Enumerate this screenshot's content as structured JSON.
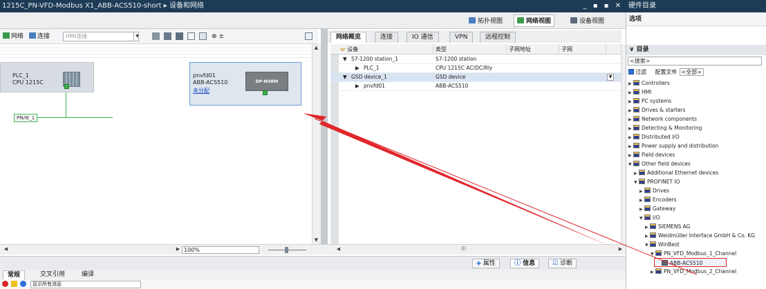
{
  "window": {
    "title": "1215C_PN-VFD-Modbus X1_ABB-ACS510-short ▸ 设备和网络",
    "controls": "_ ▪ ▪ ✕",
    "right_title": "硬件目录"
  },
  "views": {
    "topology": "拓扑视图",
    "network": "网络视图",
    "device": "设备视图"
  },
  "toolbar": {
    "network": "网络",
    "connect": "连接",
    "hmi_placeholder": "HMI连接",
    "zoom_icon": "⊕ ±"
  },
  "canvas": {
    "plc": {
      "name": "PLC_1",
      "type": "CPU 1215C"
    },
    "vfd": {
      "name": "pnvfd01",
      "type": "ABB-ACS510",
      "status": "未分配",
      "module": "DP-NORM"
    },
    "subnet": "PN/IE_1"
  },
  "tabs": [
    "网络概览",
    "连接",
    "IO 通信",
    "VPN",
    "远程控制"
  ],
  "table": {
    "headers": [
      "设备",
      "类型",
      "子网地址",
      "子网"
    ],
    "rows": [
      {
        "indent": 1,
        "expand": "▼",
        "device": "S7-1200 station_1",
        "type": "S7-1200 station"
      },
      {
        "indent": 2,
        "expand": "▶",
        "device": "PLC_1",
        "type": "CPU 1215C AC/DC/Rly"
      },
      {
        "indent": 1,
        "expand": "▼",
        "device": "GSD device_1",
        "type": "GSD device",
        "selected": true
      },
      {
        "indent": 2,
        "expand": "▶",
        "device": "pnvfd01",
        "type": "ABB-ACS510"
      }
    ]
  },
  "bottom": {
    "zoom": "100%",
    "scroll_marker": "III"
  },
  "inspector": {
    "properties": "属性",
    "info": "信息",
    "diagnostics": "诊断"
  },
  "general_tabs": [
    "常规",
    "交叉引用",
    "编译"
  ],
  "messages": {
    "filter": "显示所有消息"
  },
  "catalog": {
    "options": "选项",
    "title": "目录",
    "search": "<搜索>",
    "filter": "过滤",
    "profile": "配置文件",
    "profile_value": "<全部>",
    "tree": [
      {
        "level": 0,
        "exp": "▶",
        "label": "Controllers",
        "icon": "folder"
      },
      {
        "level": 0,
        "exp": "▶",
        "label": "HMI",
        "icon": "folder"
      },
      {
        "level": 0,
        "exp": "▶",
        "label": "PC systems",
        "icon": "folder"
      },
      {
        "level": 0,
        "exp": "▶",
        "label": "Drives & starters",
        "icon": "folder"
      },
      {
        "level": 0,
        "exp": "▶",
        "label": "Network components",
        "icon": "folder"
      },
      {
        "level": 0,
        "exp": "▶",
        "label": "Detecting & Monitoring",
        "icon": "folder"
      },
      {
        "level": 0,
        "exp": "▶",
        "label": "Distributed I/O",
        "icon": "folder"
      },
      {
        "level": 0,
        "exp": "▶",
        "label": "Power supply and distribution",
        "icon": "folder"
      },
      {
        "level": 0,
        "exp": "▶",
        "label": "Field devices",
        "icon": "folder"
      },
      {
        "level": 0,
        "exp": "▼",
        "label": "Other field devices",
        "icon": "folder"
      },
      {
        "level": 1,
        "exp": "▶",
        "label": "Additional Ethernet devices",
        "icon": "folder"
      },
      {
        "level": 1,
        "exp": "▼",
        "label": "PROFINET IO",
        "icon": "folder"
      },
      {
        "level": 2,
        "exp": "▶",
        "label": "Drives",
        "icon": "folder"
      },
      {
        "level": 2,
        "exp": "▶",
        "label": "Encoders",
        "icon": "folder"
      },
      {
        "level": 2,
        "exp": "▶",
        "label": "Gateway",
        "icon": "folder"
      },
      {
        "level": 2,
        "exp": "▼",
        "label": "I/O",
        "icon": "folder"
      },
      {
        "level": 3,
        "exp": "▶",
        "label": "SIEMENS AG",
        "icon": "folder"
      },
      {
        "level": 3,
        "exp": "▶",
        "label": "Weidmüller Interface GmbH & Co. KG",
        "icon": "folder"
      },
      {
        "level": 3,
        "exp": "▼",
        "label": "WinBest",
        "icon": "folder"
      },
      {
        "level": 4,
        "exp": "▼",
        "label": "PN_VFD_Modbus_1_Channel",
        "icon": "folder"
      },
      {
        "level": 5,
        "exp": "",
        "label": "ABB-ACS510",
        "icon": "device",
        "highlight": true
      },
      {
        "level": 4,
        "exp": "▶",
        "label": "PN_VFD_Modbus_2_Channel",
        "icon": "folder"
      }
    ]
  },
  "colors": {
    "title_bg": "#1e3b55",
    "port_green": "#3ab54a",
    "arrow_red": "#e0262a",
    "selection": "#d9e4f3",
    "link_blue": "#1a4ec9"
  }
}
